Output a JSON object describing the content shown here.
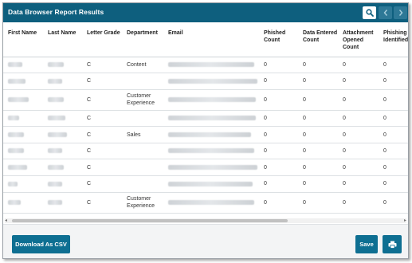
{
  "window": {
    "title": "Data Browser Report Results"
  },
  "icons": {
    "search": "search-icon",
    "prev": "chevron-left-icon",
    "next": "chevron-right-icon",
    "print": "printer-icon"
  },
  "colors": {
    "header_bg": "#0e5f7e",
    "button_bg": "#0e6f92",
    "nav_button_bg": "#2d7896"
  },
  "table": {
    "columns": [
      "First Name",
      "Last Name",
      "Letter Grade",
      "Department",
      "Email",
      "Phished Count",
      "Data Entered Count",
      "Attachment Opened Count",
      "Phishing Simulations Identified"
    ],
    "rows": [
      {
        "grade": "C",
        "department": "Content",
        "phished": "0",
        "data_entered": "0",
        "attachment_opened": "0",
        "phishing_identified": "0"
      },
      {
        "grade": "C",
        "department": "",
        "phished": "0",
        "data_entered": "0",
        "attachment_opened": "0",
        "phishing_identified": "0"
      },
      {
        "grade": "C",
        "department": "Customer Experience",
        "phished": "0",
        "data_entered": "0",
        "attachment_opened": "0",
        "phishing_identified": "0"
      },
      {
        "grade": "C",
        "department": "",
        "phished": "0",
        "data_entered": "0",
        "attachment_opened": "0",
        "phishing_identified": "0"
      },
      {
        "grade": "C",
        "department": "Sales",
        "phished": "0",
        "data_entered": "0",
        "attachment_opened": "0",
        "phishing_identified": "0"
      },
      {
        "grade": "C",
        "department": "",
        "phished": "0",
        "data_entered": "0",
        "attachment_opened": "0",
        "phishing_identified": "0"
      },
      {
        "grade": "C",
        "department": "",
        "phished": "0",
        "data_entered": "0",
        "attachment_opened": "0",
        "phishing_identified": "0"
      },
      {
        "grade": "C",
        "department": "",
        "phished": "0",
        "data_entered": "0",
        "attachment_opened": "0",
        "phishing_identified": "0"
      },
      {
        "grade": "C",
        "department": "Customer Experience",
        "phished": "0",
        "data_entered": "0",
        "attachment_opened": "0",
        "phishing_identified": "0"
      }
    ]
  },
  "footer": {
    "download_label": "Download As CSV",
    "save_label": "Save"
  }
}
